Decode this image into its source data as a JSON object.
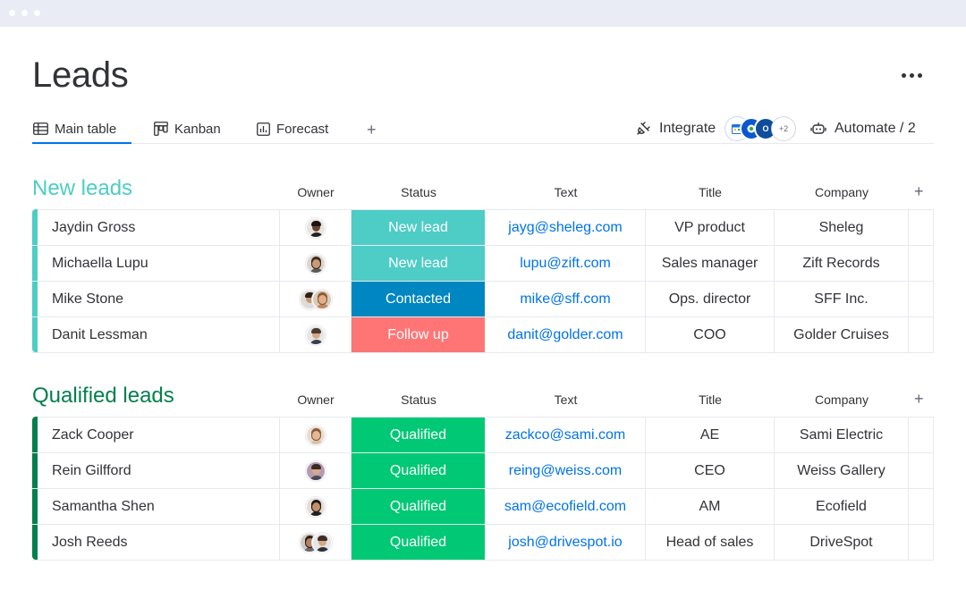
{
  "page": {
    "title": "Leads",
    "more_label": "More actions"
  },
  "tabs": [
    {
      "label": "Main table",
      "icon": "table-icon",
      "active": true
    },
    {
      "label": "Kanban",
      "icon": "kanban-icon",
      "active": false
    },
    {
      "label": "Forecast",
      "icon": "chart-icon",
      "active": false
    }
  ],
  "toolbar": {
    "add_view_label": "+",
    "integrate_label": "Integrate",
    "integration_icons": [
      {
        "name": "calendar-integration-icon",
        "color": "#1a73e8"
      },
      {
        "name": "google-integration-icon",
        "color": "#0b57d0"
      },
      {
        "name": "outlook-integration-icon",
        "color": "#0f4c9c"
      }
    ],
    "integration_more": "+2",
    "automate_label": "Automate / 2"
  },
  "columns": {
    "owner": "Owner",
    "status": "Status",
    "text": "Text",
    "title": "Title",
    "company": "Company",
    "add": "+"
  },
  "colors": {
    "accent": "#0073ea",
    "new_leads_group": "#4ecdc4",
    "qualified_group": "#037f4c",
    "status_new_lead": "#4eccc6",
    "status_contacted": "#0086c0",
    "status_follow_up": "#ff7575",
    "status_qualified": "#00c875"
  },
  "groups": [
    {
      "title": "New leads",
      "color": "#4ecdc4",
      "rows": [
        {
          "name": "Jaydin Gross",
          "owners": 1,
          "status": "New lead",
          "status_color": "#4eccc6",
          "text": "jayg@sheleg.com",
          "title": "VP product",
          "company": "Sheleg"
        },
        {
          "name": "Michaella Lupu",
          "owners": 1,
          "status": "New lead",
          "status_color": "#4eccc6",
          "text": "lupu@zift.com",
          "title": "Sales manager",
          "company": "Zift Records"
        },
        {
          "name": "Mike Stone",
          "owners": 2,
          "status": "Contacted",
          "status_color": "#0086c0",
          "text": "mike@sff.com",
          "title": "Ops. director",
          "company": "SFF Inc."
        },
        {
          "name": "Danit Lessman",
          "owners": 1,
          "status": "Follow up",
          "status_color": "#ff7575",
          "text": "danit@golder.com",
          "title": "COO",
          "company": "Golder Cruises"
        }
      ]
    },
    {
      "title": "Qualified leads",
      "color": "#037f4c",
      "rows": [
        {
          "name": "Zack Cooper",
          "owners": 1,
          "status": "Qualified",
          "status_color": "#00c875",
          "text": "zackco@sami.com",
          "title": "AE",
          "company": "Sami Electric"
        },
        {
          "name": "Rein Gilfford",
          "owners": 1,
          "status": "Qualified",
          "status_color": "#00c875",
          "text": "reing@weiss.com",
          "title": "CEO",
          "company": "Weiss Gallery"
        },
        {
          "name": "Samantha Shen",
          "owners": 1,
          "status": "Qualified",
          "status_color": "#00c875",
          "text": "sam@ecofield.com",
          "title": "AM",
          "company": "Ecofield"
        },
        {
          "name": "Josh Reeds",
          "owners": 2,
          "status": "Qualified",
          "status_color": "#00c875",
          "text": "josh@drivespot.io",
          "title": "Head of sales",
          "company": "DriveSpot"
        }
      ]
    }
  ]
}
